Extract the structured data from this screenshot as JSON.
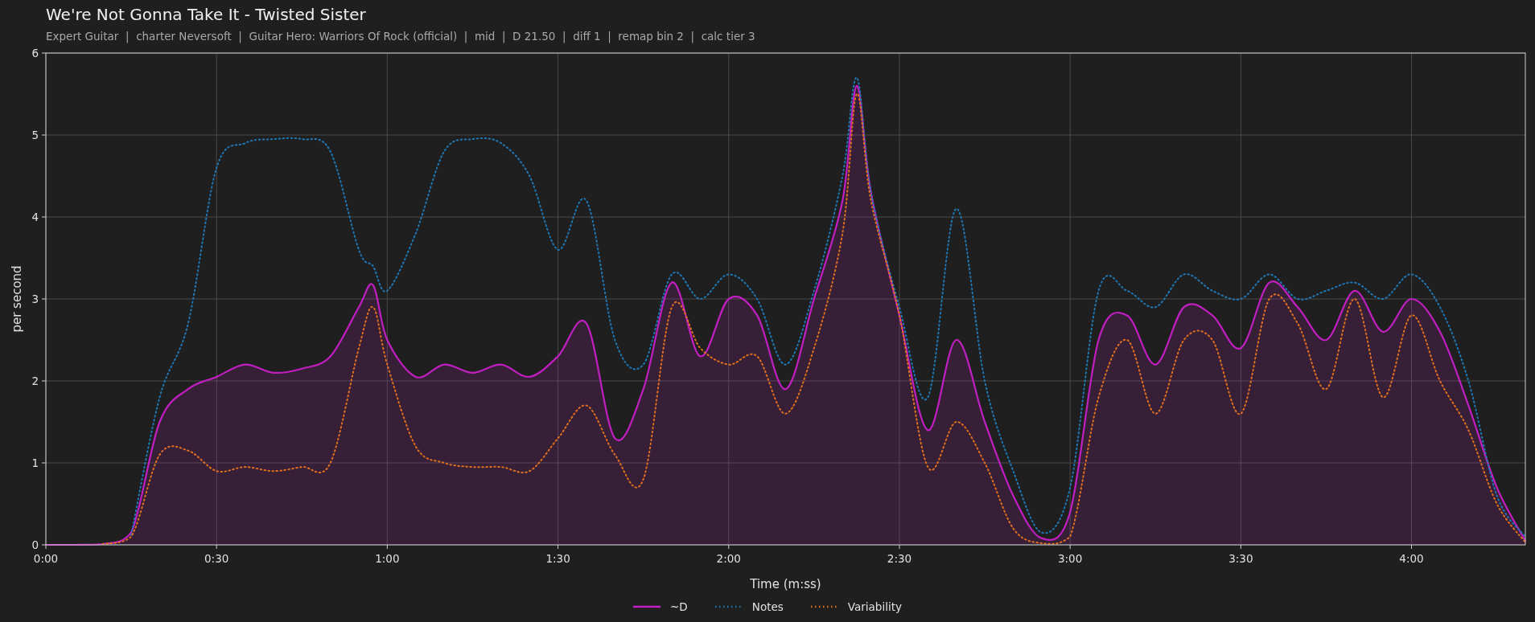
{
  "title": "We're Not Gonna Take It - Twisted Sister",
  "subtitle": "Expert Guitar  |  charter Neversoft  |  Guitar Hero: Warriors Of Rock (official)  |  mid  |  D 21.50  |  diff 1  |  remap bin 2  |  calc tier 3",
  "chart_data": {
    "type": "line",
    "xlabel": "Time (m:ss)",
    "ylabel": "per second",
    "grid": true,
    "legend": true,
    "x": [
      0,
      5,
      10,
      15,
      20,
      25,
      30,
      35,
      40,
      45,
      50,
      55,
      57.5,
      60,
      65,
      70,
      75,
      80,
      85,
      90,
      95,
      100,
      105,
      110,
      115,
      120,
      125,
      130,
      135,
      140,
      142.5,
      145,
      150,
      155,
      160,
      165,
      170,
      175,
      180,
      185,
      190,
      195,
      200,
      205,
      210,
      215,
      220,
      225,
      230,
      235,
      240,
      245,
      250,
      255,
      260
    ],
    "series": [
      {
        "name": "~D",
        "color": "#c21fc2",
        "type": "area",
        "line_style": "solid",
        "values": [
          0,
          0,
          0.01,
          0.15,
          1.5,
          1.9,
          2.05,
          2.2,
          2.1,
          2.15,
          2.3,
          2.9,
          3.17,
          2.5,
          2.05,
          2.2,
          2.1,
          2.2,
          2.05,
          2.3,
          2.7,
          1.3,
          1.9,
          3.2,
          2.3,
          3.0,
          2.8,
          1.9,
          3.0,
          4.2,
          5.6,
          4.3,
          2.8,
          1.4,
          2.5,
          1.5,
          0.6,
          0.08,
          0.4,
          2.5,
          2.8,
          2.2,
          2.9,
          2.8,
          2.4,
          3.2,
          2.9,
          2.5,
          3.1,
          2.6,
          3.0,
          2.6,
          1.7,
          0.7,
          0.05
        ]
      },
      {
        "name": "Notes",
        "color": "#1f77b4",
        "type": "line",
        "line_style": "dotted",
        "values": [
          null,
          null,
          null,
          0.12,
          1.8,
          2.7,
          4.6,
          4.9,
          4.95,
          4.95,
          4.8,
          3.6,
          3.4,
          3.1,
          3.8,
          4.8,
          4.95,
          4.9,
          4.5,
          3.6,
          4.2,
          2.5,
          2.2,
          3.3,
          3.0,
          3.3,
          3.0,
          2.2,
          3.1,
          4.5,
          5.7,
          4.3,
          2.9,
          1.8,
          4.1,
          2.0,
          0.9,
          0.15,
          0.7,
          3.1,
          3.1,
          2.9,
          3.3,
          3.1,
          3.0,
          3.3,
          3.0,
          3.1,
          3.2,
          3.0,
          3.3,
          2.9,
          2.0,
          0.6,
          0.1
        ]
      },
      {
        "name": "Variability",
        "color": "#e0701e",
        "type": "line",
        "line_style": "dotted",
        "values": [
          null,
          null,
          0.01,
          0.1,
          1.1,
          1.15,
          0.9,
          0.95,
          0.9,
          0.95,
          1.0,
          2.4,
          2.9,
          2.2,
          1.2,
          1.0,
          0.95,
          0.95,
          0.9,
          1.3,
          1.7,
          1.1,
          0.8,
          2.9,
          2.4,
          2.2,
          2.3,
          1.6,
          2.4,
          3.8,
          5.5,
          4.2,
          2.8,
          0.95,
          1.5,
          1.0,
          0.2,
          0.02,
          0.1,
          1.8,
          2.5,
          1.6,
          2.5,
          2.5,
          1.6,
          3.0,
          2.7,
          1.9,
          3.0,
          1.8,
          2.8,
          2.0,
          1.4,
          0.5,
          0.03
        ]
      }
    ],
    "xlim": [
      0,
      260
    ],
    "ylim": [
      0,
      6
    ],
    "xticks": [
      {
        "value": 0,
        "label": "0:00"
      },
      {
        "value": 30,
        "label": "0:30"
      },
      {
        "value": 60,
        "label": "1:00"
      },
      {
        "value": 90,
        "label": "1:30"
      },
      {
        "value": 120,
        "label": "2:00"
      },
      {
        "value": 150,
        "label": "2:30"
      },
      {
        "value": 180,
        "label": "3:00"
      },
      {
        "value": 210,
        "label": "3:30"
      },
      {
        "value": 240,
        "label": "4:00"
      }
    ],
    "yticks": [
      0,
      1,
      2,
      3,
      4,
      5,
      6
    ]
  }
}
